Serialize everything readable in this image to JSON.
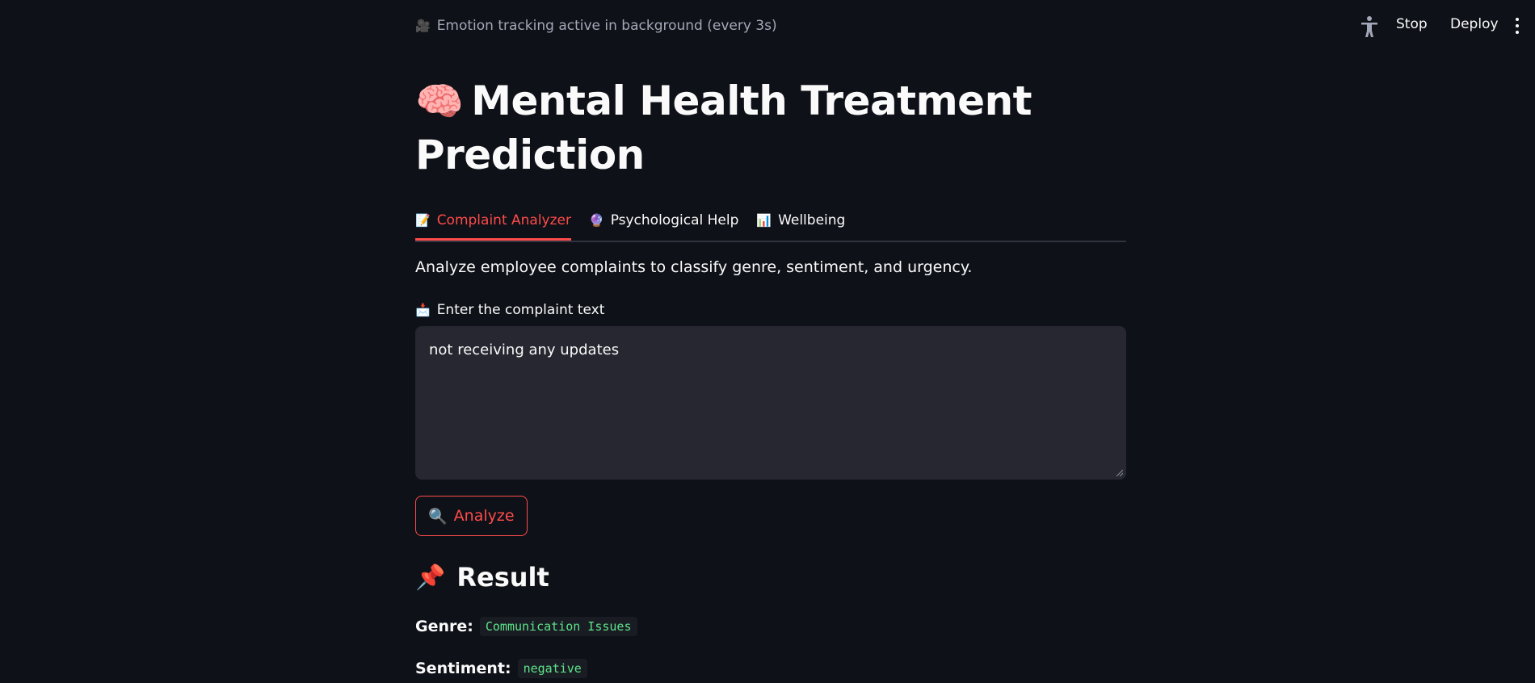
{
  "topbar": {
    "status_icon": "camera-icon",
    "status_text": "Emotion tracking active in background (every 3s)",
    "stop_label": "Stop",
    "deploy_label": "Deploy"
  },
  "page": {
    "title_emoji": "🧠",
    "title": "Mental Health Treatment Prediction"
  },
  "tabs": [
    {
      "icon": "📝",
      "label": "Complaint Analyzer",
      "active": true
    },
    {
      "icon": "🔮",
      "label": "Psychological Help",
      "active": false
    },
    {
      "icon": "📊",
      "label": "Wellbeing",
      "active": false
    }
  ],
  "analyzer": {
    "description": "Analyze employee complaints to classify genre, sentiment, and urgency.",
    "field_icon": "📩",
    "field_label": "Enter the complaint text",
    "complaint_value": "not receiving any updates",
    "analyze_icon": "🔍",
    "analyze_label": "Analyze"
  },
  "result": {
    "title_icon": "📌",
    "title": "Result",
    "genre_label": "Genre:",
    "genre_value": "Communication Issues",
    "sentiment_label": "Sentiment:",
    "sentiment_value": "negative"
  },
  "colors": {
    "background": "#0e1117",
    "accent": "#ff4b4b",
    "input_bg": "#262730",
    "code_text": "#5ce488"
  }
}
